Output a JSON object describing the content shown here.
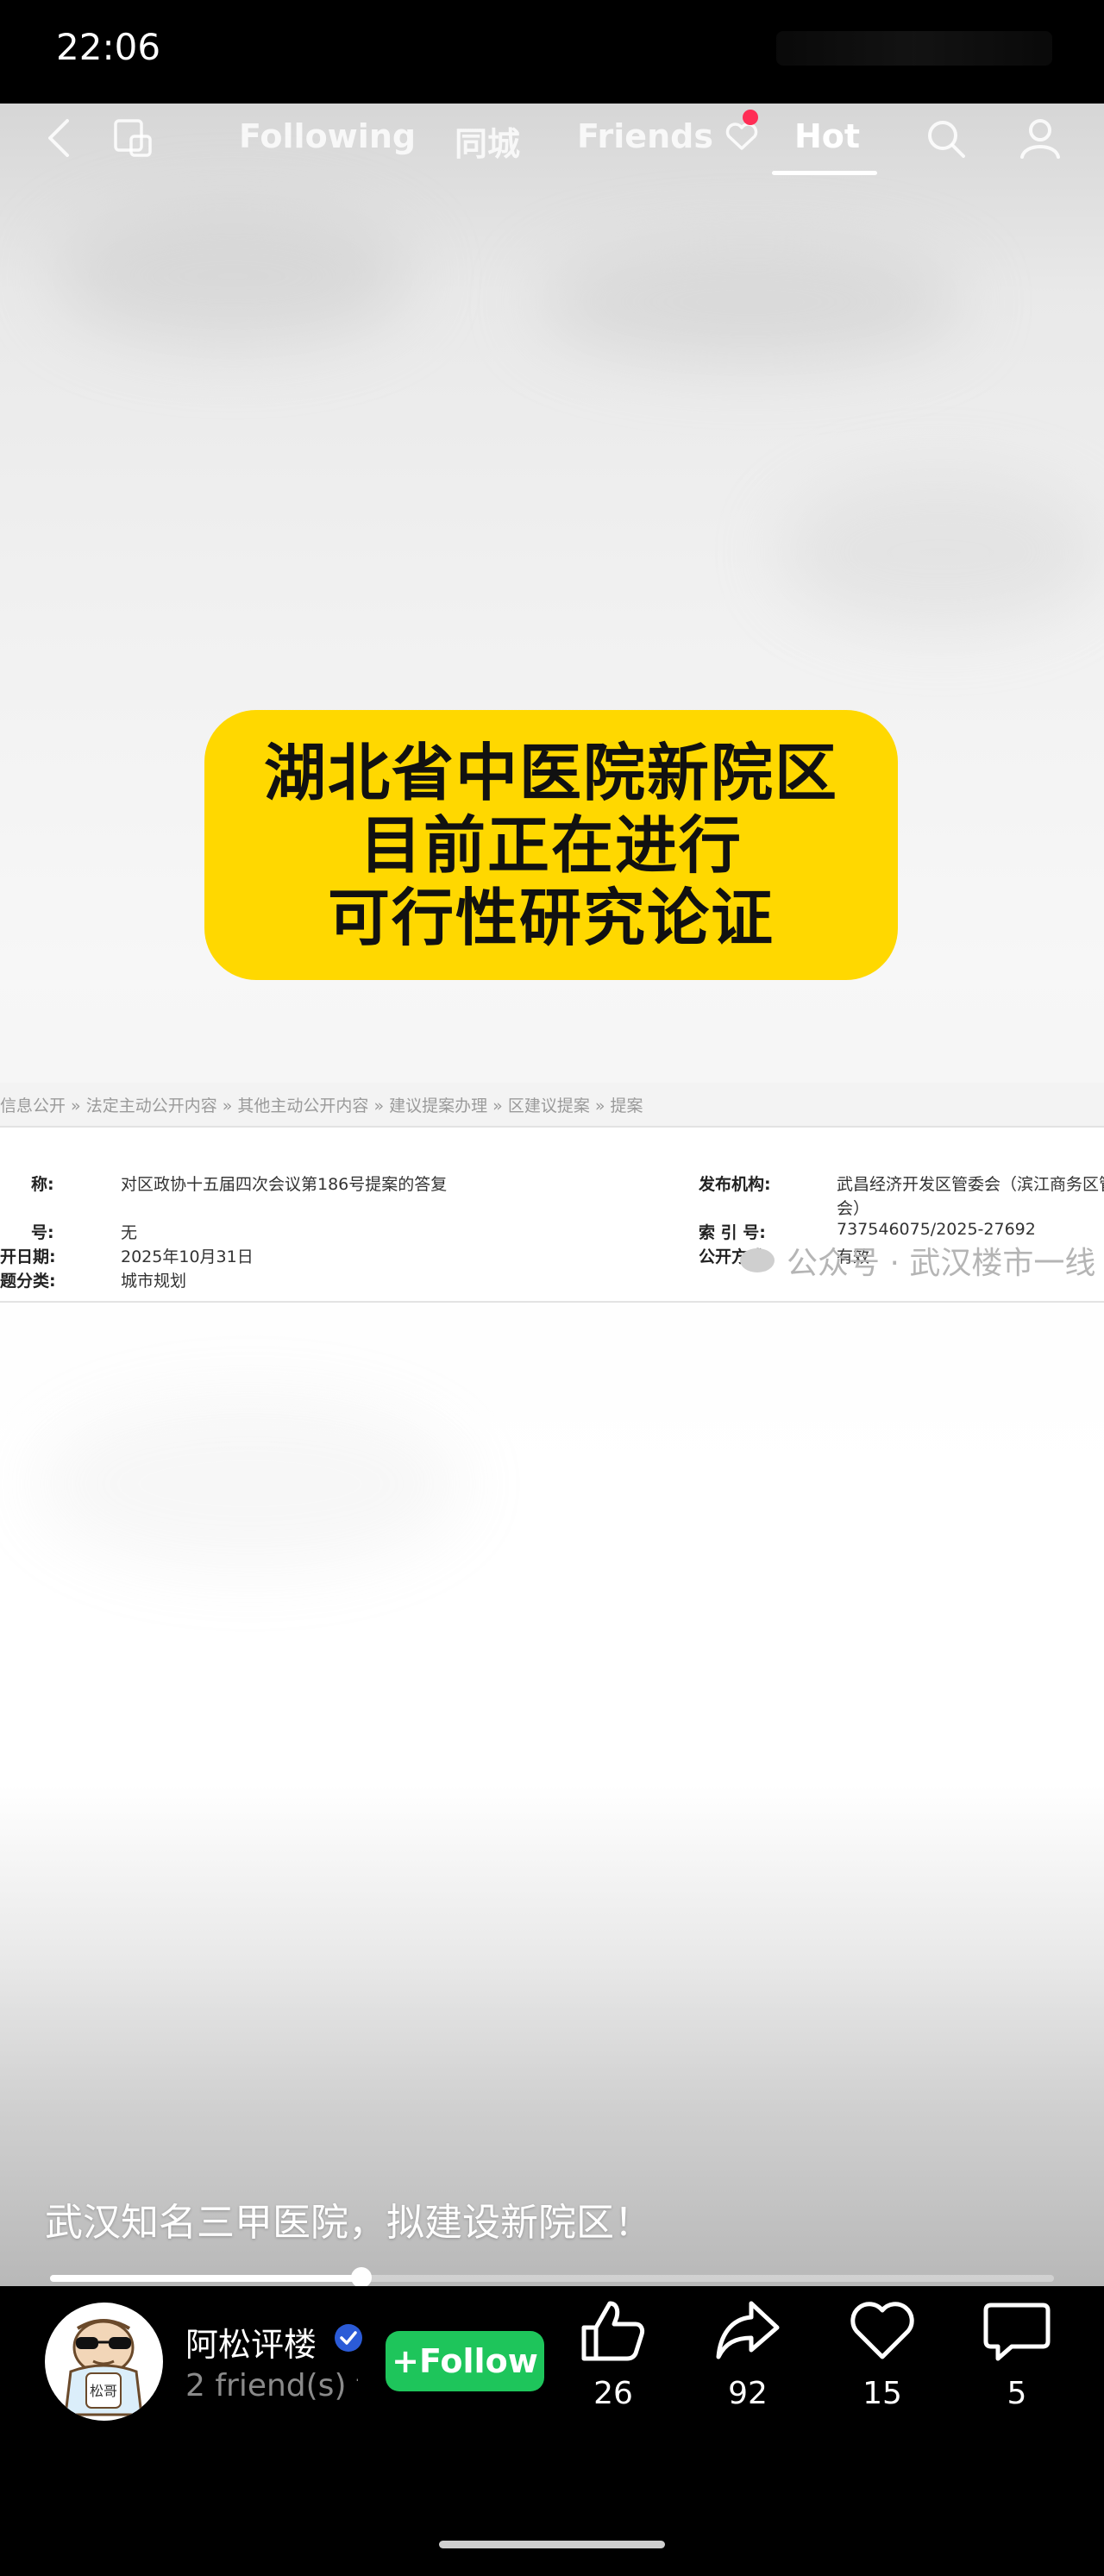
{
  "status": {
    "time": "22:06"
  },
  "nav": {
    "tabs": [
      "Following",
      "同城",
      "Friends",
      "Hot"
    ],
    "active_tab": "Hot",
    "icons": [
      "back-icon",
      "multi-window-icon",
      "heart-icon",
      "search-icon",
      "profile-icon"
    ]
  },
  "headline": {
    "lines": [
      "湖北省中医院新院区",
      "目前正在进行",
      "可行性研究论证"
    ]
  },
  "document": {
    "breadcrumb": "信息公开 » 法定主动公开内容 » 其他主动公开内容 » 建议提案办理 » 区建议提案 » 提案",
    "name_label": "称:",
    "name_value": "对区政协十五届四次会议第186号提案的答复",
    "number_label": "号:",
    "number_value": "无",
    "date_label": "开日期:",
    "date_value": "2025年10月31日",
    "category_label": "题分类:",
    "category_value": "城市规划",
    "publisher_label": "发布机构:",
    "publisher_value": "武昌经济开发区管委会（滨江商务区管",
    "publisher_value_2": "会）",
    "index_label": "索 引 号:",
    "index_value": "737546075/2025-27692",
    "mode_label": "公开方式:",
    "mode_value": "有效",
    "watermark": "公众号 · 武汉楼市一线"
  },
  "video": {
    "caption": "武汉知名三甲医院，拟建设新院区！",
    "progress_fraction": 0.31
  },
  "author": {
    "name": "阿松评楼",
    "friends": "2 friend(s) f",
    "follow_label": "+Follow",
    "avatar_text": "松哥"
  },
  "actions": [
    {
      "name": "like",
      "icon": "thumbs-up-icon",
      "count": "26"
    },
    {
      "name": "share",
      "icon": "share-icon",
      "count": "92"
    },
    {
      "name": "favorite",
      "icon": "heart-icon",
      "count": "15"
    },
    {
      "name": "comment",
      "icon": "comment-icon",
      "count": "5"
    }
  ],
  "colors": {
    "headline_bg": "#ffd800",
    "follow_green": "#1ec55b",
    "badge_red": "#ff2d55"
  }
}
